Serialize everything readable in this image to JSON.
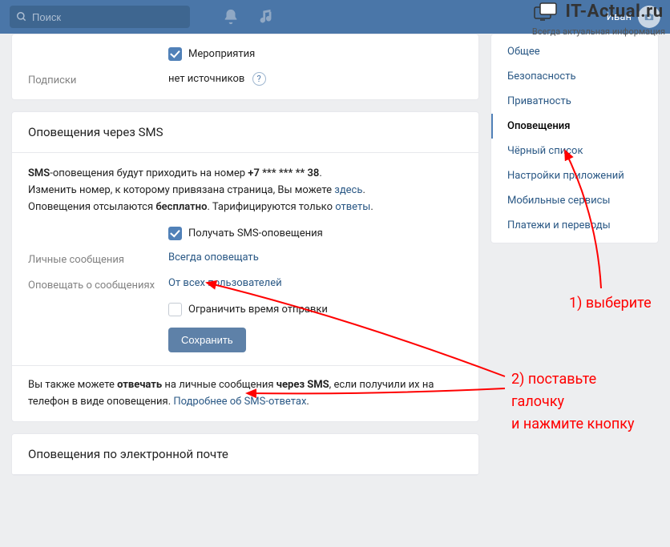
{
  "header": {
    "search_placeholder": "Поиск",
    "username": "Иван"
  },
  "watermark": {
    "title": "IT-Actual.ru",
    "subtitle": "Всегда актуальная информация"
  },
  "sidebar": {
    "items": [
      {
        "label": "Общее",
        "active": false
      },
      {
        "label": "Безопасность",
        "active": false
      },
      {
        "label": "Приватность",
        "active": false
      },
      {
        "label": "Оповещения",
        "active": true
      },
      {
        "label": "Чёрный список",
        "active": false
      },
      {
        "label": "Настройки приложений",
        "active": false
      },
      {
        "label": "Мобильные сервисы",
        "active": false
      },
      {
        "label": "Платежи и переводы",
        "active": false
      }
    ]
  },
  "section_top": {
    "events_checkbox_label": "Мероприятия",
    "subscriptions_label": "Подписки",
    "subscriptions_value": "нет источников"
  },
  "section_sms": {
    "head": "Оповещения через SMS",
    "info_prefix": "SMS",
    "info_text1": "-оповещения будут приходить на номер ",
    "phone": "+7 *** *** ** 38",
    "info_text2": "Изменить номер, к которому привязана страница, Вы можете ",
    "link_here": "здесь",
    "info_text3": "Оповещения отсылаются ",
    "free": "бесплатно",
    "info_text4": ". Тарифицируются только ",
    "link_replies": "ответы",
    "receive_sms_label": "Получать SMS-оповещения",
    "private_msg_label": "Личные сообщения",
    "private_msg_value": "Всегда оповещать",
    "notify_about_label": "Оповещать о сообщениях",
    "notify_about_value": "От всех пользователей",
    "limit_time_label": "Ограничить время отправки",
    "save_button": "Сохранить",
    "footnote_1": "Вы также можете ",
    "footnote_b1": "отвечать",
    "footnote_2": " на личные сообщения ",
    "footnote_b2": "через SMS",
    "footnote_3": ", если получили их на телефон в виде оповещения. ",
    "footnote_link": "Подробнее об SMS-ответах"
  },
  "section_email": {
    "head": "Оповещения по электронной почте"
  },
  "annotations": {
    "a1": "1) выберите",
    "a2_l1": "2) поставьте",
    "a2_l2": "галочку",
    "a2_l3": "и нажмите кнопку"
  }
}
